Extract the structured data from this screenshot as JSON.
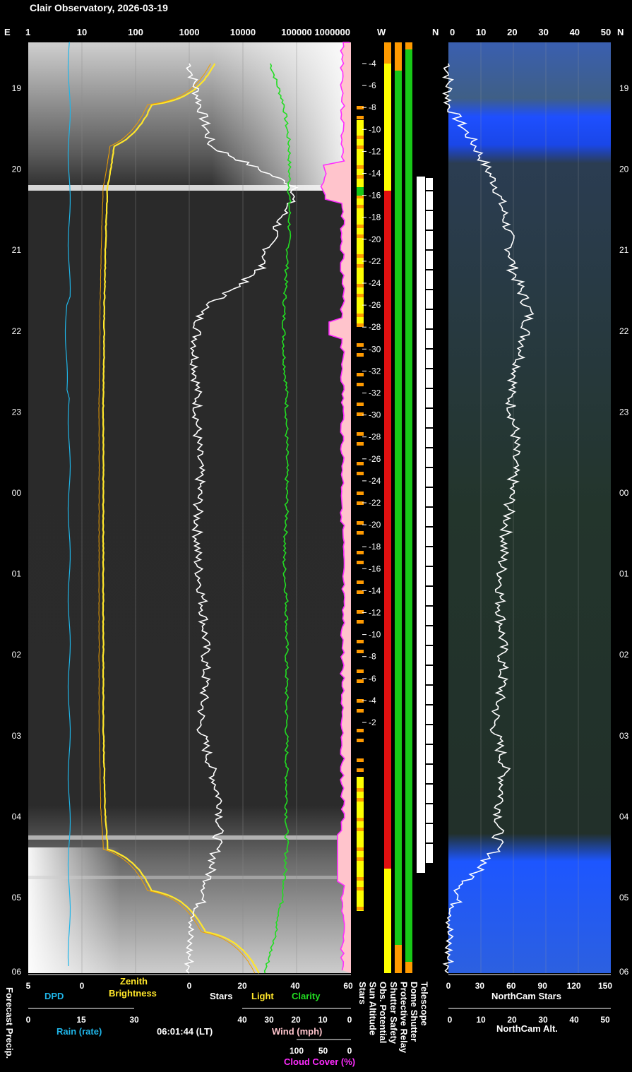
{
  "title": "Clair Observatory, 2026-03-19",
  "hours": [
    "19",
    "20",
    "21",
    "22",
    "23",
    "00",
    "01",
    "02",
    "03",
    "04",
    "05",
    "06"
  ],
  "compass": {
    "e": "E",
    "w": "W",
    "n": "N",
    "n2": "N"
  },
  "top_axis": [
    "1",
    "10",
    "100",
    "1000",
    "10000",
    "100000",
    "1000000"
  ],
  "right_top_axis": [
    "0",
    "10",
    "20",
    "30",
    "40",
    "50"
  ],
  "sun_altitude_ticks": [
    "-4",
    "-6",
    "-8",
    "-10",
    "-12",
    "-14",
    "-16",
    "-18",
    "-20",
    "-22",
    "-24",
    "-26",
    "-28",
    "-30",
    "-32",
    "-32",
    "-30",
    "-28",
    "-26",
    "-24",
    "-22",
    "-20",
    "-18",
    "-16",
    "-14",
    "-12",
    "-10",
    "-8",
    "-6",
    "-4",
    "-2"
  ],
  "bottom": {
    "dpd_ticks": [
      "5",
      "0"
    ],
    "dpd_label": "DPD",
    "rain_ticks": [
      "0",
      "15",
      "30"
    ],
    "rain_label": "Rain (rate)",
    "zenith_label_1": "Zenith",
    "zenith_label_2": "Brightness",
    "stars_ticks": [
      "0",
      "20",
      "40",
      "60"
    ],
    "stars_label": "Stars",
    "light_label": "Light",
    "clarity_label": "Clarity",
    "wind_ticks": [
      "40",
      "30",
      "20",
      "10",
      "0"
    ],
    "wind_label": "Wind (mph)",
    "cloud_ticks": [
      "100",
      "50",
      "0"
    ],
    "cloud_label": "Cloud Cover (%)",
    "time_label": "06:01:44 (LT)",
    "forecast_label": "Forecast Precip.",
    "column_labels": [
      "Stars",
      "Sun Altitude",
      "Obs. Potential",
      "Shutter Safety",
      "Protective Relay",
      "Dome Shutter",
      "Telescope"
    ],
    "northcam_stars_ticks": [
      "0",
      "30",
      "60",
      "90",
      "120",
      "150"
    ],
    "northcam_stars_label": "NorthCam Stars",
    "northcam_alt_ticks": [
      "0",
      "10",
      "20",
      "30",
      "40",
      "50"
    ],
    "northcam_alt_label": "NorthCam Alt."
  },
  "colors": {
    "rain": "#1fb5e8",
    "zenith": "#ffe62a",
    "stars": "#ffffff",
    "clarity": "#22dd22",
    "cloud": "#ff2cff",
    "cloud_fill": "#ffc4cc",
    "obs_red": "#e01010",
    "safe_green": "#17c817",
    "warn_orange": "#ff9a00",
    "warn_yellow": "#ffff00",
    "northcam_blue": "#1b55ff"
  },
  "chart_data": {
    "type": "line",
    "x": [
      "19:00",
      "19:30",
      "20:00",
      "20:30",
      "21:00",
      "21:30",
      "22:00",
      "22:30",
      "23:00",
      "23:30",
      "00:00",
      "00:30",
      "01:00",
      "01:30",
      "02:00",
      "02:30",
      "03:00",
      "03:30",
      "04:00",
      "04:30",
      "05:00",
      "05:30",
      "06:00"
    ],
    "series": [
      {
        "name": "Zenith Brightness",
        "values": [
          3000,
          200,
          40,
          30,
          28,
          27,
          26,
          26,
          25,
          25,
          25,
          25,
          25,
          25,
          25,
          25,
          25,
          26,
          27,
          30,
          200,
          2000,
          20000
        ]
      },
      {
        "name": "Stars",
        "values": [
          0,
          4,
          8,
          40,
          32,
          26,
          4,
          2,
          3,
          3,
          4,
          3,
          3,
          5,
          6,
          6,
          4,
          8,
          12,
          10,
          6,
          0,
          0
        ]
      },
      {
        "name": "Clarity",
        "values": [
          30,
          35,
          37,
          37,
          37,
          36,
          35,
          35,
          36,
          36,
          36,
          36,
          35,
          36,
          36,
          36,
          36,
          36,
          36,
          36,
          35,
          32,
          28
        ]
      },
      {
        "name": "NorthCam Stars",
        "values": [
          0,
          0,
          25,
          45,
          55,
          60,
          75,
          68,
          57,
          62,
          60,
          55,
          50,
          48,
          50,
          50,
          42,
          52,
          48,
          45,
          10,
          0,
          0
        ]
      }
    ]
  }
}
